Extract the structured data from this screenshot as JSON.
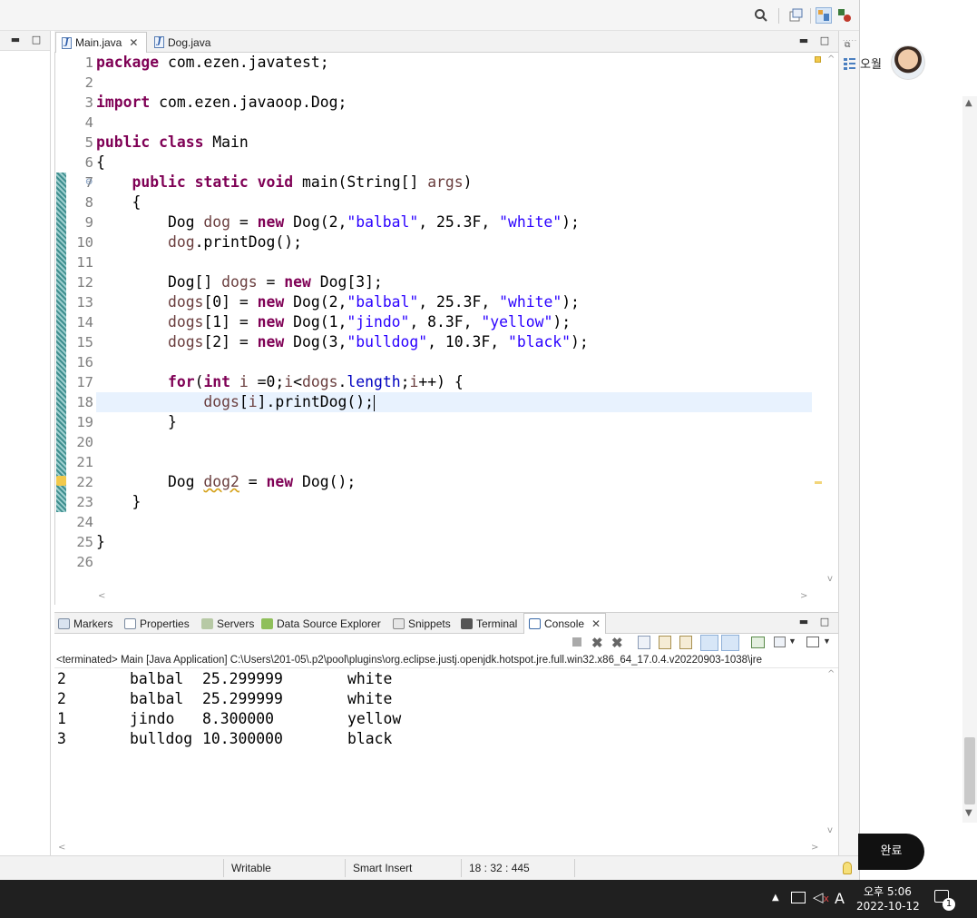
{
  "editor": {
    "tabs": [
      {
        "label": "Main.java",
        "close": "✕"
      },
      {
        "label": "Dog.java"
      }
    ],
    "line_numbers": [
      "1",
      "2",
      "3",
      "4",
      "5",
      "6",
      "7",
      "8",
      "9",
      "10",
      "11",
      "12",
      "13",
      "14",
      "15",
      "16",
      "17",
      "18",
      "19",
      "20",
      "21",
      "22",
      "23",
      "24",
      "25",
      "26"
    ]
  },
  "console": {
    "tabs": [
      "Markers",
      "Properties",
      "Servers",
      "Data Source Explorer",
      "Snippets",
      "Terminal",
      "Console"
    ],
    "close": "✕",
    "status": "<terminated> Main [Java Application] C:\\Users\\201-05\\.p2\\pool\\plugins\\org.eclipse.justj.openjdk.hotspot.jre.full.win32.x86_64_17.0.4.v20220903-1038\\jre",
    "output": [
      {
        "age": "2",
        "name": "balbal",
        "weight": "25.299999",
        "color": "white"
      },
      {
        "age": "2",
        "name": "balbal",
        "weight": "25.299999",
        "color": "white"
      },
      {
        "age": "1",
        "name": "jindo",
        "weight": "8.300000",
        "color": "yellow"
      },
      {
        "age": "3",
        "name": "bulldog",
        "weight": "10.300000",
        "color": "black"
      }
    ]
  },
  "status_bar": {
    "writable": "Writable",
    "insert_mode": "Smart Insert",
    "position": "18 : 32 : 445"
  },
  "right_app": {
    "user_name": "오월",
    "done_button": "완료"
  },
  "taskbar": {
    "ime": "A",
    "time": "오후 5:06",
    "date": "2022-10-12",
    "notification_count": "1"
  }
}
